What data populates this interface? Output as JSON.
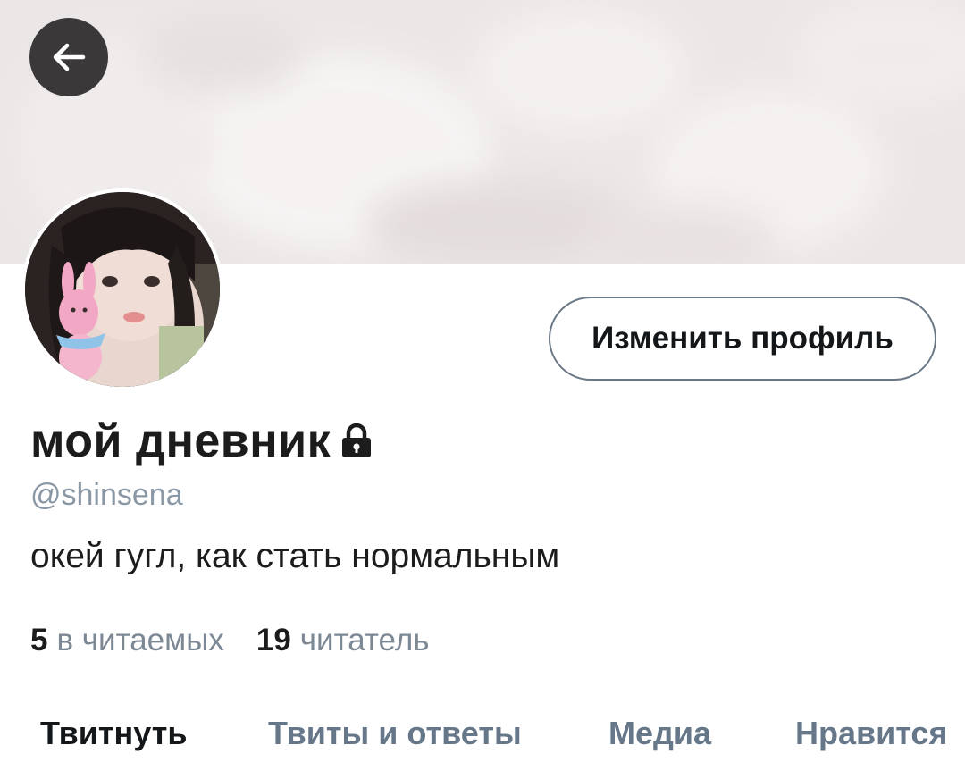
{
  "header": {
    "back_icon": "arrow-left-icon"
  },
  "profile": {
    "display_name": "мой дневник",
    "lock_icon": "lock-icon",
    "handle": "@shinsena",
    "bio": "окей гугл, как стать нормальным",
    "edit_label": "Изменить профиль"
  },
  "stats": [
    {
      "count": "5",
      "label": "в читаемых"
    },
    {
      "count": "19",
      "label": "читатель"
    }
  ],
  "tabs": [
    {
      "label": "Твитнуть",
      "active": true
    },
    {
      "label": "Твиты и ответы",
      "active": false
    },
    {
      "label": "Медиа",
      "active": false
    },
    {
      "label": "Нравится",
      "active": false
    }
  ],
  "colors": {
    "secondary_text": "#8a97a5",
    "inactive_tab": "#66778a",
    "button_border": "#6b7887"
  }
}
